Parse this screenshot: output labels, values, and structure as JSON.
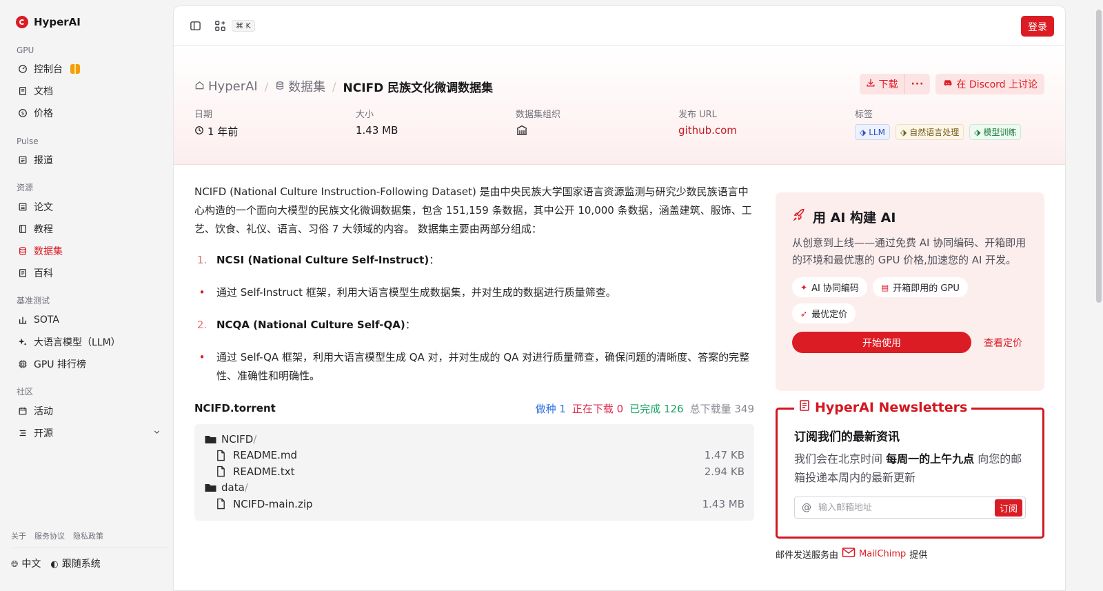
{
  "brand": {
    "name": "HyperAI"
  },
  "sidebar": {
    "sections": [
      {
        "title": "GPU",
        "items": [
          {
            "label": "控制台"
          },
          {
            "label": "文档"
          },
          {
            "label": "价格"
          }
        ]
      },
      {
        "title": "Pulse",
        "items": [
          {
            "label": "报道"
          }
        ]
      },
      {
        "title": "资源",
        "items": [
          {
            "label": "论文"
          },
          {
            "label": "教程"
          },
          {
            "label": "数据集"
          },
          {
            "label": "百科"
          }
        ]
      },
      {
        "title": "基准测试",
        "items": [
          {
            "label": "SOTA"
          },
          {
            "label": "大语言模型（LLM）"
          },
          {
            "label": "GPU 排行榜"
          }
        ]
      },
      {
        "title": "社区",
        "items": [
          {
            "label": "活动"
          },
          {
            "label": "开源"
          }
        ]
      }
    ],
    "footer_links": [
      "关于",
      "服务协议",
      "隐私政策"
    ],
    "language": "中文",
    "theme": "跟随系统"
  },
  "topbar": {
    "shortcut": "⌘ K",
    "login": "登录"
  },
  "breadcrumb": {
    "home": "HyperAI",
    "section": "数据集",
    "current": "NCIFD 民族文化微调数据集"
  },
  "actions": {
    "download": "下载",
    "more": "···",
    "discord": "在 Discord 上讨论"
  },
  "meta": {
    "date_label": "日期",
    "date_value": "1 年前",
    "size_label": "大小",
    "size_value": "1.43 MB",
    "org_label": "数据集组织",
    "url_label": "发布 URL",
    "url_value": "github.com",
    "tags_label": "标签",
    "tags": [
      "LLM",
      "自然语言处理",
      "模型训练"
    ]
  },
  "content": {
    "intro": "NCIFD (National Culture Instruction-Following Dataset) 是由中央民族大学国家语言资源监测与研究少数民族语言中心构造的一个面向大模型的民族文化微调数据集，包含 151,159 条数据，其中公开 10,000 条数据，涵盖建筑、服饰、工艺、饮食、礼仪、语言、习俗 7 大领域的内容。 数据集主要由两部分组成：",
    "item1_num": "1.",
    "item1_title": "NCSI (National Culture Self-Instruct)",
    "item1_colon": "：",
    "item1_desc": "通过 Self-Instruct 框架，利用大语言模型生成数据集，并对生成的数据进行质量筛查。",
    "item2_num": "2.",
    "item2_title": "NCQA (National Culture Self-QA)",
    "item2_colon": "：",
    "item2_desc": "通过 Self-QA 框架，利用大语言模型生成 QA 对，并对生成的 QA 对进行质量筛查，确保问题的清晰度、答案的完整性、准确性和明确性。"
  },
  "torrent": {
    "name": "NCIFD.torrent",
    "seeding": "做种 1",
    "downloading": "正在下载 0",
    "completed": "已完成 126",
    "total": "总下载量 349",
    "files": [
      {
        "name": "NCIFD",
        "slash": "/",
        "size": ""
      },
      {
        "name": "README.md",
        "size": "1.47 KB"
      },
      {
        "name": "README.txt",
        "size": "2.94 KB"
      },
      {
        "name": "data",
        "slash": "/",
        "size": ""
      },
      {
        "name": "NCIFD-main.zip",
        "size": "1.43 MB"
      }
    ]
  },
  "promo": {
    "title": "用 AI 构建 AI",
    "desc": "从创意到上线——通过免费 AI 协同编码、开箱即用的环境和最优惠的 GPU 价格,加速您的 AI 开发。",
    "chips": [
      "AI 协同编码",
      "开箱即用的 GPU",
      "最优定价"
    ],
    "start": "开始使用",
    "pricing": "查看定价"
  },
  "newsletter": {
    "legend": "HyperAI Newsletters",
    "heading": "订阅我们的最新资讯",
    "text_pre": "我们会在北京时间 ",
    "text_bold": "每周一的上午九点",
    "text_post": " 向您的邮箱投递本周内的最新更新",
    "placeholder": "输入邮箱地址",
    "subscribe": "订阅",
    "note_pre": "邮件发送服务由",
    "note_brand": "MailChimp",
    "note_post": "提供"
  },
  "colors": {
    "accent": "#dc1c24"
  }
}
